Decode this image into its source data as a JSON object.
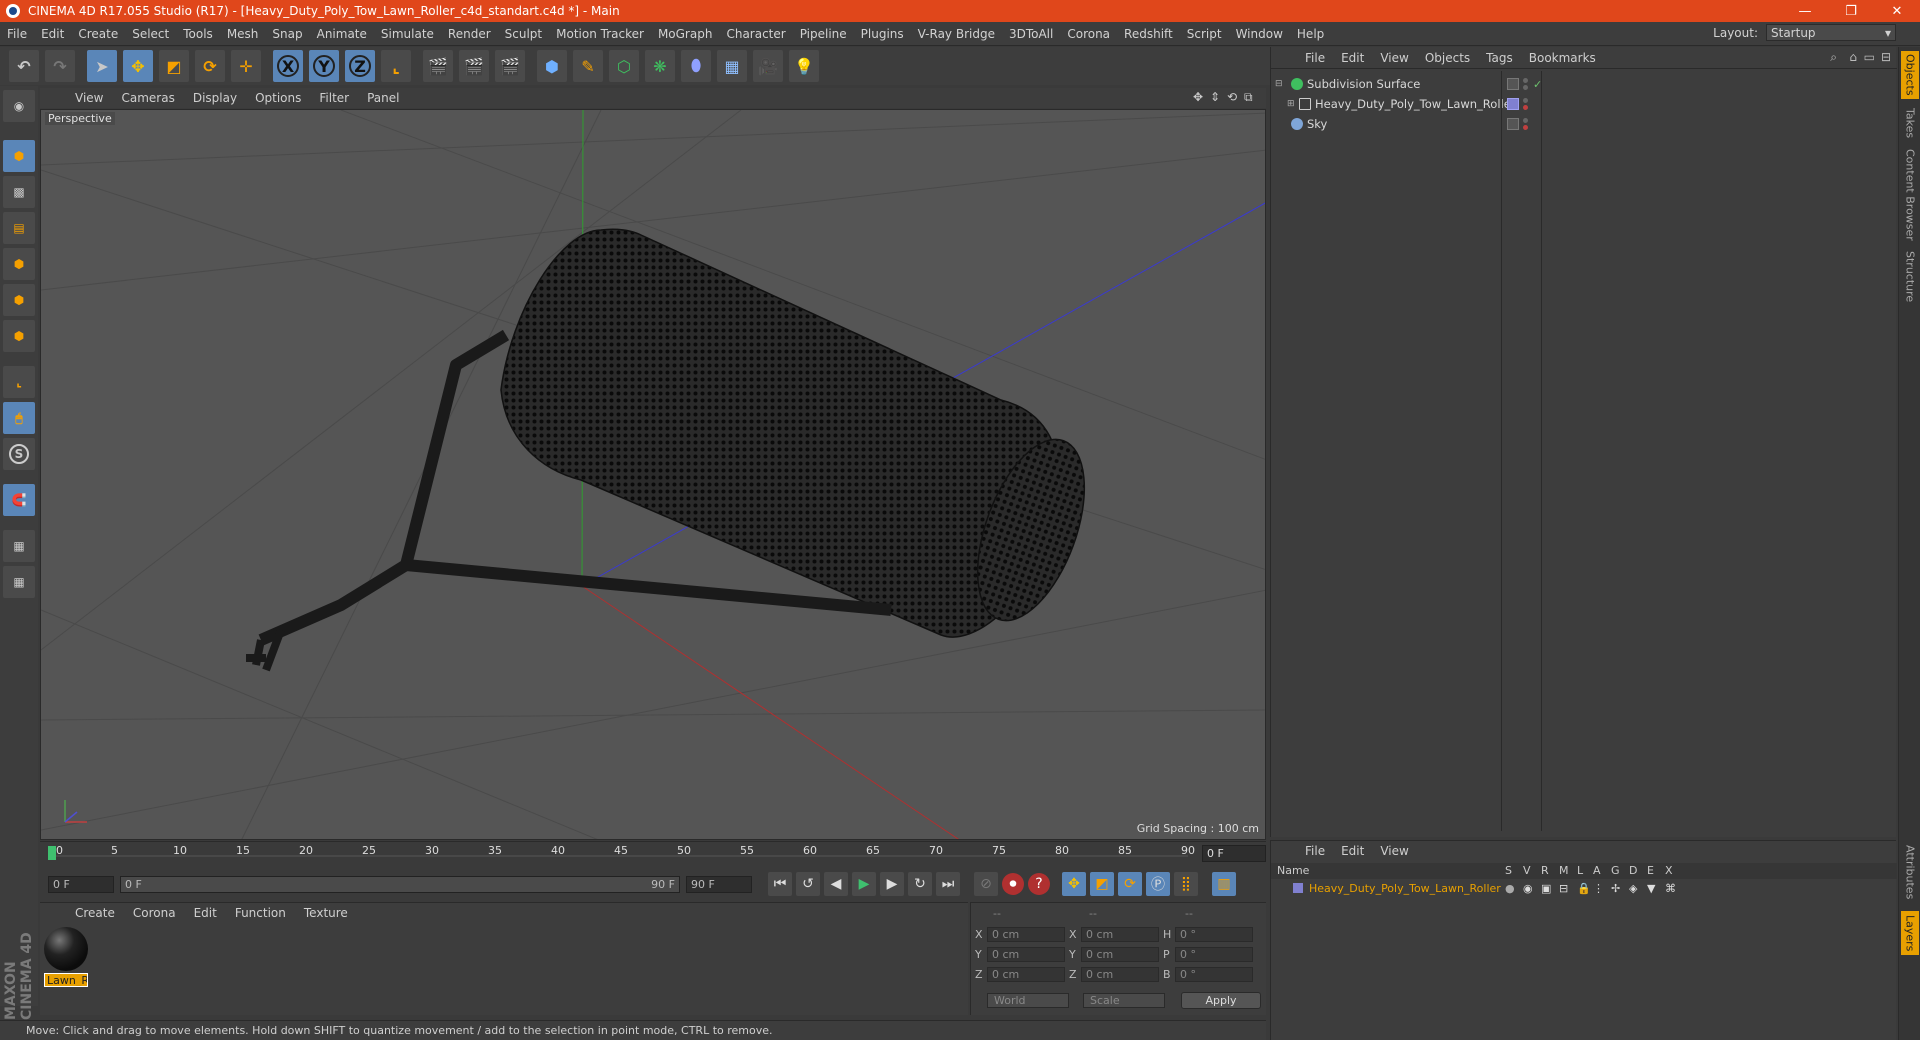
{
  "window": {
    "title": "CINEMA 4D R17.055 Studio (R17) - [Heavy_Duty_Poly_Tow_Lawn_Roller_c4d_standart.c4d *] - Main",
    "minimize": "—",
    "maximize": "❐",
    "close": "✕"
  },
  "menubar": {
    "items": [
      "File",
      "Edit",
      "Create",
      "Select",
      "Tools",
      "Mesh",
      "Snap",
      "Animate",
      "Simulate",
      "Render",
      "Sculpt",
      "Motion Tracker",
      "MoGraph",
      "Character",
      "Pipeline",
      "Plugins",
      "V-Ray Bridge",
      "3DToAll",
      "Corona",
      "Redshift",
      "Script",
      "Window",
      "Help"
    ],
    "layout_label": "Layout:",
    "layout_value": "Startup"
  },
  "toolbar": {
    "x_label": "X",
    "y_label": "Y",
    "z_label": "Z"
  },
  "viewport": {
    "menu": [
      "View",
      "Cameras",
      "Display",
      "Options",
      "Filter",
      "Panel"
    ],
    "label": "Perspective",
    "grid_spacing": "Grid Spacing : 100 cm"
  },
  "timeline": {
    "ticks": [
      "0",
      "5",
      "10",
      "15",
      "20",
      "25",
      "30",
      "35",
      "40",
      "45",
      "50",
      "55",
      "60",
      "65",
      "70",
      "75",
      "80",
      "85",
      "90"
    ],
    "current_frame": "0 F",
    "start_frame": "0 F",
    "range_start": "0 F",
    "range_end": "90 F",
    "end_frame": "90 F"
  },
  "material_manager": {
    "menu": [
      "Create",
      "Corona",
      "Edit",
      "Function",
      "Texture"
    ],
    "material_name": "Lawn_R"
  },
  "coordinates": {
    "headers": [
      "--",
      "--",
      "--"
    ],
    "rows": [
      {
        "a": "X",
        "av": "0 cm",
        "b": "X",
        "bv": "0 cm",
        "c": "H",
        "cv": "0 °"
      },
      {
        "a": "Y",
        "av": "0 cm",
        "b": "Y",
        "bv": "0 cm",
        "c": "P",
        "cv": "0 °"
      },
      {
        "a": "Z",
        "av": "0 cm",
        "b": "Z",
        "bv": "0 cm",
        "c": "B",
        "cv": "0 °"
      }
    ],
    "mode": "World",
    "scale": "Scale",
    "apply": "Apply"
  },
  "status": "Move: Click and drag to move elements. Hold down SHIFT to quantize movement / add to the selection in point mode, CTRL to remove.",
  "object_manager": {
    "menu": [
      "File",
      "Edit",
      "View",
      "Objects",
      "Tags",
      "Bookmarks"
    ],
    "objects": [
      {
        "name": "Subdivision Surface",
        "color": "#3fbf5f"
      },
      {
        "name": "Heavy_Duty_Poly_Tow_Lawn_Roller",
        "color": "#c9c9c9"
      },
      {
        "name": "Sky",
        "color": "#7fa6d8"
      }
    ],
    "check": "✓"
  },
  "layer_manager": {
    "menu": [
      "File",
      "Edit",
      "View"
    ],
    "columns": [
      "Name",
      "S",
      "V",
      "R",
      "M",
      "L",
      "A",
      "G",
      "D",
      "E",
      "X"
    ],
    "layer_name": "Heavy_Duty_Poly_Tow_Lawn_Roller"
  },
  "right_tabs": [
    "Objects",
    "Takes",
    "Content Browser",
    "Structure",
    "Attributes",
    "Layers"
  ],
  "brand": "MAXON CINEMA 4D",
  "colors": {
    "titlebar": "#e0471b",
    "accent_blue": "#5a86b8",
    "layer_text": "#e8a000"
  }
}
